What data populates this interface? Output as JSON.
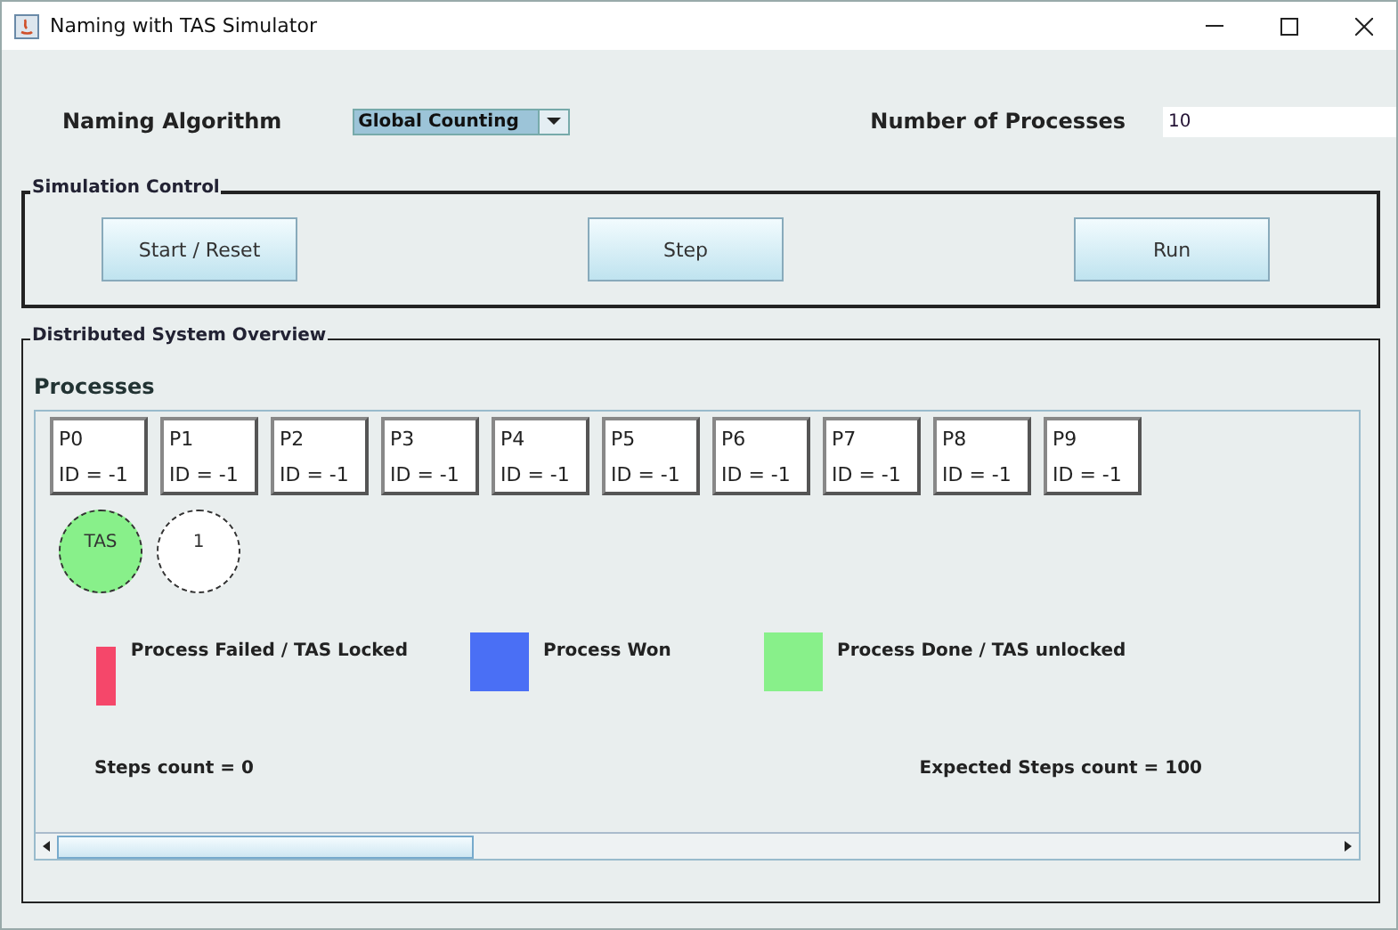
{
  "window": {
    "title": "Naming with TAS Simulator"
  },
  "naming_algorithm": {
    "label": "Naming Algorithm",
    "value": "Global Counting"
  },
  "number_of_processes": {
    "label": "Number of Processes",
    "value": "10"
  },
  "simulation_control": {
    "title": "Simulation Control",
    "buttons": [
      "Start / Reset",
      "Step",
      "Run"
    ]
  },
  "overview": {
    "title": "Distributed System Overview",
    "processes_label": "Processes",
    "processes": [
      {
        "name": "P0",
        "id": "ID = -1"
      },
      {
        "name": "P1",
        "id": "ID = -1"
      },
      {
        "name": "P2",
        "id": "ID = -1"
      },
      {
        "name": "P3",
        "id": "ID = -1"
      },
      {
        "name": "P4",
        "id": "ID = -1"
      },
      {
        "name": "P5",
        "id": "ID = -1"
      },
      {
        "name": "P6",
        "id": "ID = -1"
      },
      {
        "name": "P7",
        "id": "ID = -1"
      },
      {
        "name": "P8",
        "id": "ID = -1"
      },
      {
        "name": "P9",
        "id": "ID = -1"
      }
    ],
    "registers": [
      {
        "label": "TAS",
        "color": "#88f08a"
      },
      {
        "label": "1",
        "color": "#ffffff"
      }
    ],
    "legend": [
      {
        "label": "Process Failed / TAS Locked",
        "color": "#f5476a"
      },
      {
        "label": "Process Won",
        "color": "#4a6ff5"
      },
      {
        "label": "Process Done / TAS unlocked",
        "color": "#88f08a"
      }
    ],
    "steps_count": "Steps count = 0",
    "expected_steps_count": "Expected Steps count = 100"
  }
}
